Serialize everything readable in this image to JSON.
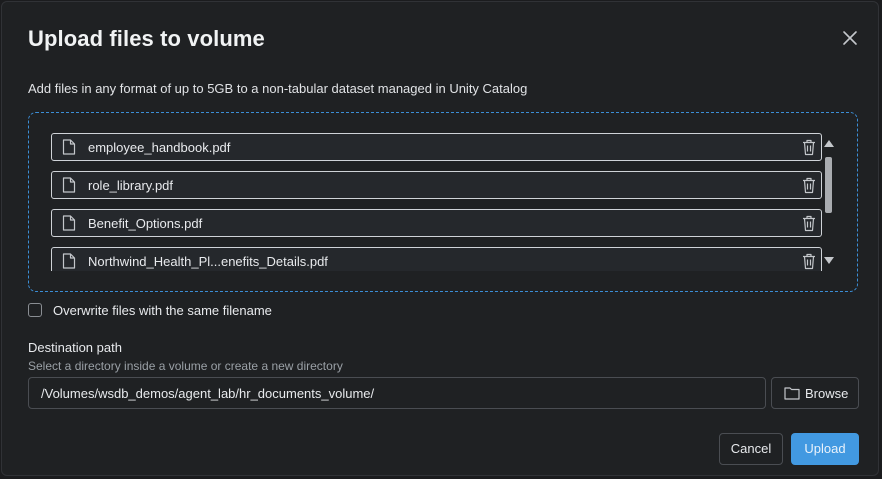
{
  "dialog": {
    "title": "Upload files to volume",
    "subtitle": "Add files in any format of up to 5GB to a non-tabular dataset managed in Unity Catalog",
    "close_icon": "close-icon"
  },
  "files": [
    {
      "name": "employee_handbook.pdf",
      "icon": "file-icon",
      "remove_icon": "trash-icon"
    },
    {
      "name": "role_library.pdf",
      "icon": "file-icon",
      "remove_icon": "trash-icon"
    },
    {
      "name": "Benefit_Options.pdf",
      "icon": "file-icon",
      "remove_icon": "trash-icon"
    },
    {
      "name": "Northwind_Health_Pl...enefits_Details.pdf",
      "icon": "file-icon",
      "remove_icon": "trash-icon"
    }
  ],
  "overwrite": {
    "label": "Overwrite files with the same filename",
    "checked": false
  },
  "destination": {
    "label": "Destination path",
    "hint": "Select a directory inside a volume or create a new directory",
    "value": "/Volumes/wsdb_demos/agent_lab/hr_documents_volume/",
    "browse_label": "Browse",
    "browse_icon": "folder-icon"
  },
  "actions": {
    "cancel_label": "Cancel",
    "upload_label": "Upload"
  },
  "colors": {
    "accent": "#4299e1",
    "dropzone_border": "#3b8ed6",
    "background": "#1f2123"
  }
}
